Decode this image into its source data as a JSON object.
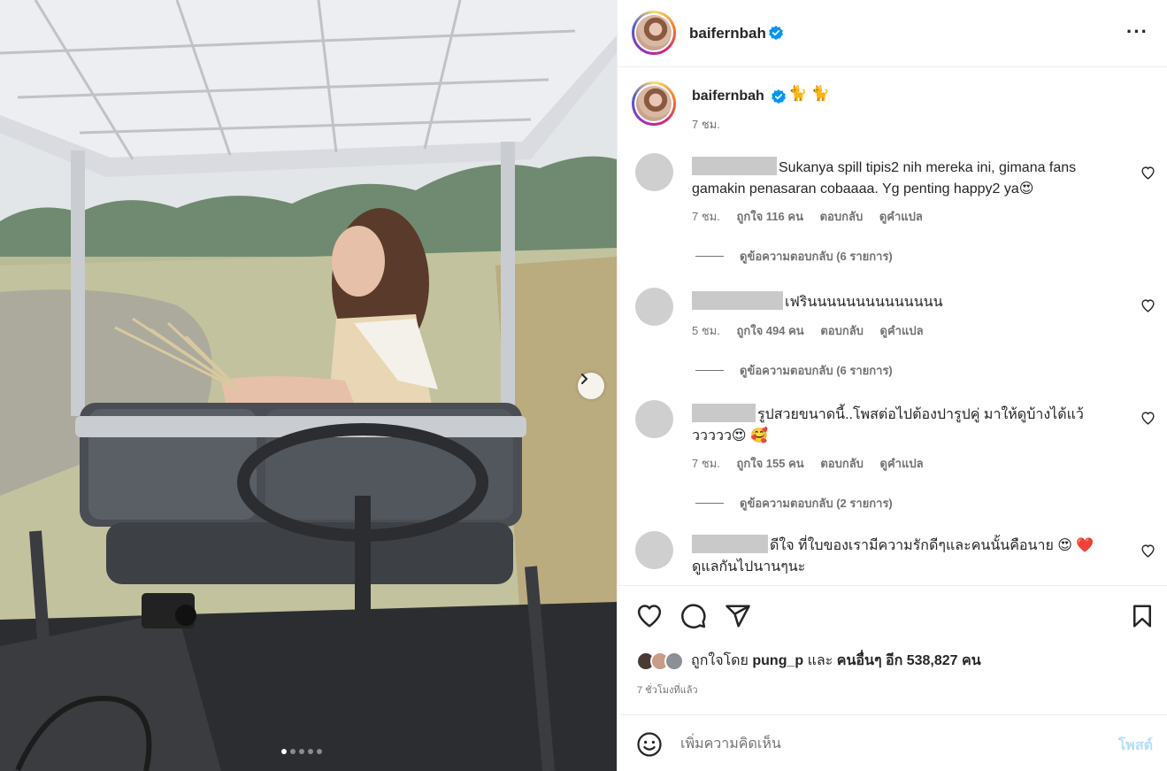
{
  "post": {
    "username": "baifernbah",
    "caption_emoji": "🐈 🐈",
    "caption_time": "7 ชม."
  },
  "comments": [
    {
      "text": "Sukanya spill tipis2 nih mereka ini, gimana fans gamakin penasaran cobaaaa. Yg penting happy2 ya😍",
      "time": "7 ชม.",
      "likes": "ถูกใจ 116 คน",
      "reply": "ตอบกลับ",
      "translate": "ดูคำแปล",
      "view_replies": "ดูข้อความตอบกลับ (6 รายการ)"
    },
    {
      "text": "เฟรินนนนนนนนนนนนนน",
      "time": "5 ชม.",
      "likes": "ถูกใจ 494 คน",
      "reply": "ตอบกลับ",
      "translate": "ดูคำแปล",
      "view_replies": "ดูข้อความตอบกลับ (6 รายการ)"
    },
    {
      "text": "รูปสวยขนาดนี้..โพสต่อไปต้องปารูปคู่ มาให้ดูบ้างได้แว้ววววว😍 🥰",
      "time": "7 ชม.",
      "likes": "ถูกใจ 155 คน",
      "reply": "ตอบกลับ",
      "translate": "ดูคำแปล",
      "view_replies": "ดูข้อความตอบกลับ (2 รายการ)"
    },
    {
      "text": "ดีใจ ที่ใบของเรามีความรักดีๆและคนนั้นคือนาย 😍 ❤️ ดูแลกันไปนานๆนะ"
    }
  ],
  "likes": {
    "prefix": "ถูกใจโดย",
    "user": "pung_p",
    "middle": "และ",
    "others": "คนอื่นๆ อีก 538,827 คน"
  },
  "posted_time": "7 ชั่วโมงที่แล้ว",
  "add_comment": {
    "placeholder": "เพิ่มความคิดเห็น",
    "post_label": "โพสต์"
  },
  "colors": {
    "verified": "#0095f6",
    "post_button_disabled": "#b2dffc",
    "secondary_text": "#737373"
  },
  "carousel": {
    "total": 5,
    "current": 1
  }
}
